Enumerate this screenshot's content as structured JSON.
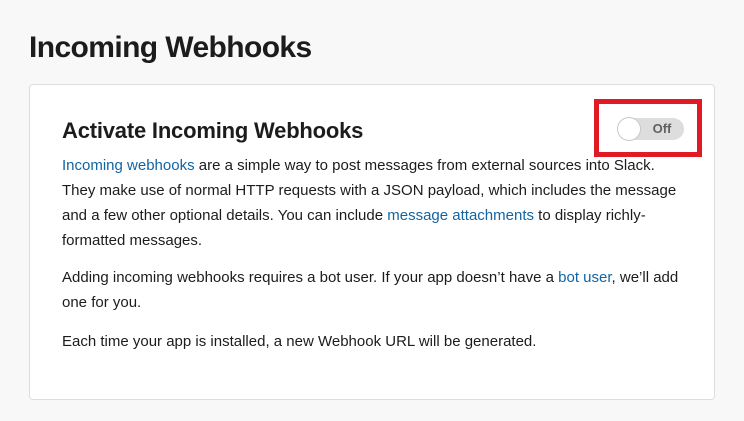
{
  "page": {
    "title": "Incoming Webhooks"
  },
  "section": {
    "heading": "Activate Incoming Webhooks",
    "toggle": {
      "state": "Off",
      "enabled": false
    },
    "paragraph1": {
      "link1": "Incoming webhooks",
      "text1": " are a simple way to post messages from external sources into Slack. They make use of normal HTTP requests with a JSON payload, which includes the message and a few other optional details. You can include ",
      "link2": "message attachments",
      "text2": " to display richly-formatted messages."
    },
    "paragraph2": {
      "text1": "Adding incoming webhooks requires a bot user. If your app doesn’t have a ",
      "link1": "bot user",
      "text2": ", we’ll add one for you."
    },
    "paragraph3": {
      "text": "Each time your app is installed, a new Webhook URL will be generated."
    }
  },
  "colors": {
    "link": "#1264a3",
    "highlight_border": "#e01b24",
    "toggle_off_bg": "#dddddd"
  }
}
